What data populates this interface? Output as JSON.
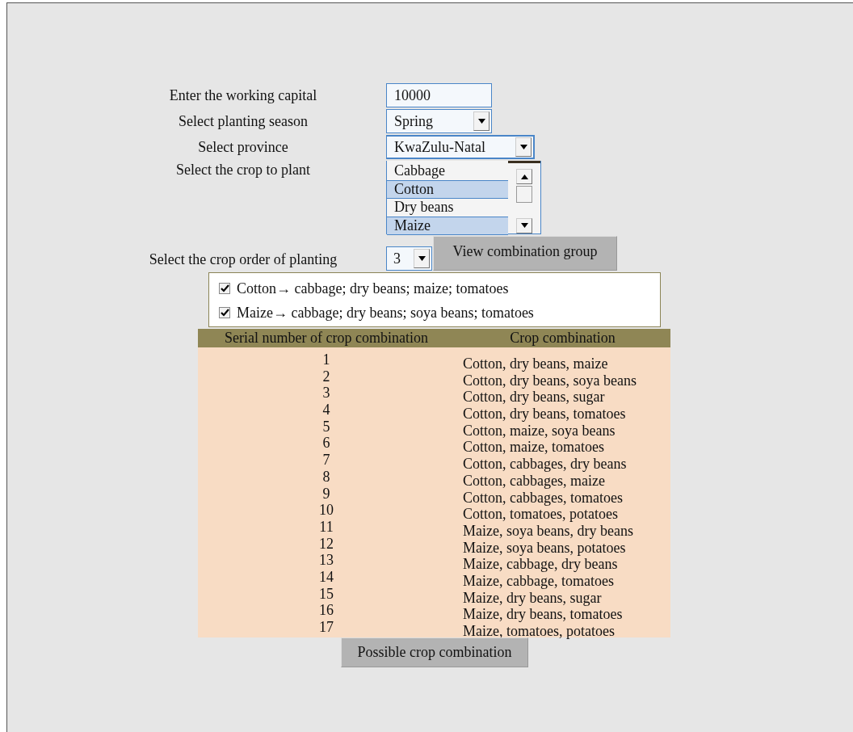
{
  "working_capital": {
    "label": "Enter the working capital",
    "value": "10000"
  },
  "season": {
    "label": "Select planting season",
    "value": "Spring"
  },
  "province": {
    "label": "Select province",
    "value": "KwaZulu-Natal"
  },
  "crop_list": {
    "label": "Select the crop to plant",
    "items": [
      {
        "label": "Cabbage",
        "selected": false
      },
      {
        "label": "Cotton",
        "selected": true
      },
      {
        "label": "Dry beans",
        "selected": false
      },
      {
        "label": "Maize",
        "selected": true
      }
    ]
  },
  "crop_order": {
    "label": "Select the crop order of planting",
    "value": "3"
  },
  "view_button": "View combination group",
  "rules": [
    {
      "text": "Cotton→ cabbage; dry beans; maize; tomatoes",
      "checked": true
    },
    {
      "text": "Maize→ cabbage; dry beans; soya beans; tomatoes",
      "checked": true
    }
  ],
  "table": {
    "columns": [
      "Serial number of crop combination",
      "Crop combination"
    ],
    "rows": [
      [
        "1",
        "Cotton, dry beans, maize"
      ],
      [
        "2",
        "Cotton, dry beans, soya beans"
      ],
      [
        "3",
        "Cotton, dry beans, sugar"
      ],
      [
        "4",
        "Cotton, dry beans, tomatoes"
      ],
      [
        "5",
        "Cotton, maize, soya beans"
      ],
      [
        "6",
        "Cotton, maize, tomatoes"
      ],
      [
        "7",
        "Cotton, cabbages, dry beans"
      ],
      [
        "8",
        "Cotton, cabbages, maize"
      ],
      [
        "9",
        "Cotton, cabbages, tomatoes"
      ],
      [
        "10",
        "Cotton, tomatoes, potatoes"
      ],
      [
        "11",
        "Maize, soya beans, dry beans"
      ],
      [
        "12",
        "Maize, soya beans, potatoes"
      ],
      [
        "13",
        "Maize, cabbage, dry beans"
      ],
      [
        "14",
        "Maize, cabbage, tomatoes"
      ],
      [
        "15",
        "Maize, dry beans, sugar"
      ],
      [
        "16",
        "Maize, dry beans, tomatoes"
      ],
      [
        "17",
        "Maize, tomatoes, potatoes"
      ]
    ]
  },
  "possible_button": "Possible crop combination"
}
